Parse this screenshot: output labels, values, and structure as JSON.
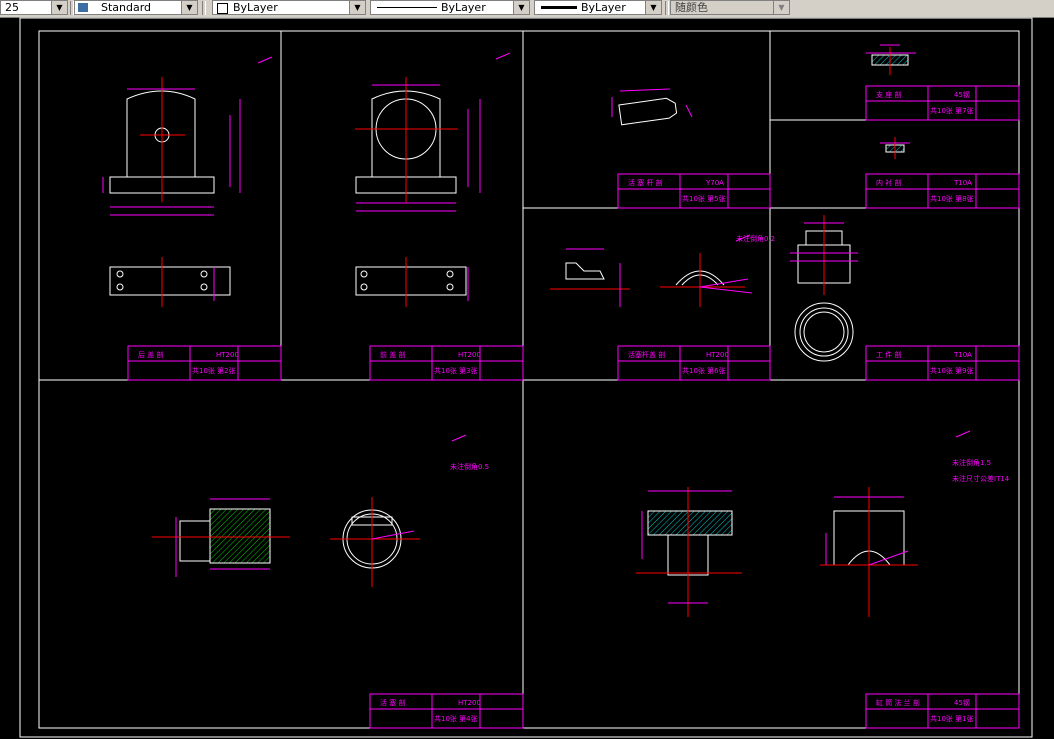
{
  "toolbar": {
    "scale_fragment": "25",
    "text_style": "Standard",
    "layer": "ByLayer",
    "linetype": "ByLayer",
    "lineweight": "ByLayer",
    "plot_style": "随颜色"
  },
  "colors": {
    "background": "#000000",
    "frame": "#ffffff",
    "dimension": "#ff00ff",
    "centerline": "#ff0000",
    "hatch_green": "#00c800",
    "hatch_cyan": "#00c8c8",
    "title_text": "#ff00ff"
  },
  "sheets": [
    {
      "title": "后 盖 剖",
      "material": "HT200",
      "page": "共10张 第2张"
    },
    {
      "title": "前 盖 剖",
      "material": "HT200",
      "page": "共10张 第3张"
    },
    {
      "title": "活 塞 杆 剖",
      "material": "Y70A",
      "page": "共10张 第5张"
    },
    {
      "title": "支 座 剖",
      "material": "45钢",
      "page": "共10张 第7张"
    },
    {
      "title": "内 衬 剖",
      "material": "T10A",
      "page": "共10张 第8张"
    },
    {
      "title": "活塞杆盖 剖",
      "material": "HT200",
      "page": "共10张 第6张"
    },
    {
      "title": "工 件 剖",
      "material": "T10A",
      "page": "共10张 第9张"
    },
    {
      "title": "活 塞 剖",
      "material": "HT200",
      "page": "共10张 第4张"
    },
    {
      "title": "缸 筒 法 兰 剖",
      "material": "45钢",
      "page": "共10张 第1张"
    }
  ],
  "notes": {
    "chamfer_a": "未注倒角0.2",
    "chamfer_b": "未注倒角0.5",
    "chamfer_c": "未注倒角1.5",
    "tolerance": "未注尺寸公差IT14"
  }
}
